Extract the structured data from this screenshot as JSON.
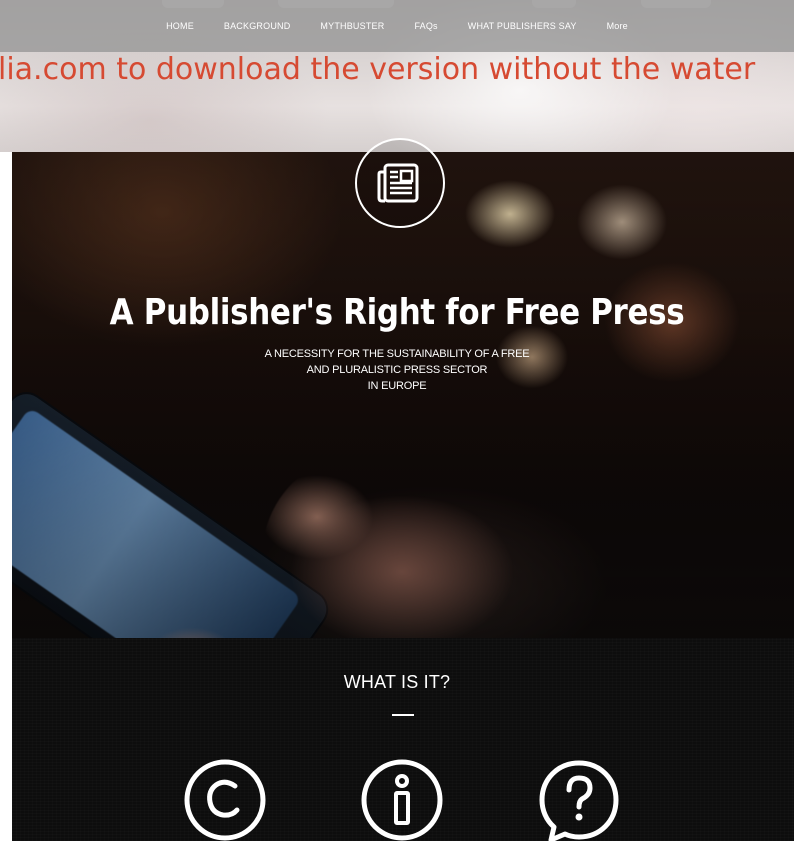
{
  "nav": {
    "items": [
      {
        "label": "HOME"
      },
      {
        "label": "BACKGROUND"
      },
      {
        "label": "MYTHBUSTER"
      },
      {
        "label": "FAQs"
      },
      {
        "label": "WHAT PUBLISHERS SAY"
      },
      {
        "label": "More"
      }
    ]
  },
  "watermark": {
    "text": "lia.com to download the version without the water"
  },
  "hero": {
    "title": "A Publisher's Right for Free Press",
    "subtitle": {
      "line1": "A NECESSITY FOR THE SUSTAINABILITY OF A FREE",
      "line2": "AND PLURALISTIC PRESS SECTOR",
      "line3": "IN EUROPE"
    },
    "icon": "newspaper-icon"
  },
  "section": {
    "title": "WHAT IS IT?",
    "icons": [
      "copyright-icon",
      "info-icon",
      "question-bubble-icon"
    ]
  },
  "colors": {
    "watermark": "#d64a32",
    "nav_text": "#ffffff",
    "hero_text": "#ffffff",
    "section_bg": "#0d0d0d"
  }
}
